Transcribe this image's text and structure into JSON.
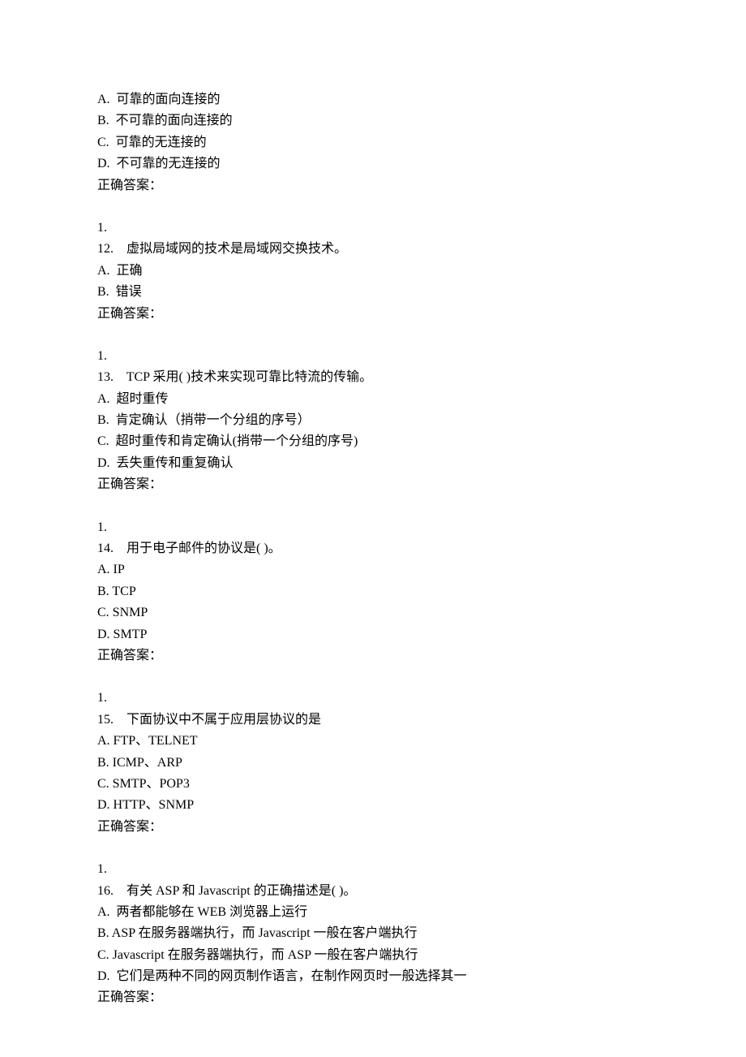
{
  "blocks": [
    {
      "lines": [
        "A.  可靠的面向连接的",
        "B.  不可靠的面向连接的",
        "C.  可靠的无连接的",
        "D.  不可靠的无连接的",
        "正确答案："
      ]
    },
    {
      "lines": [
        "1.",
        "12.    虚拟局域网的技术是局域网交换技术。",
        "A.  正确",
        "B.  错误",
        "正确答案："
      ]
    },
    {
      "lines": [
        "1.",
        "13.    TCP 采用( )技术来实现可靠比特流的传输。",
        "A.  超时重传",
        "B.  肯定确认（捎带一个分组的序号）",
        "C.  超时重传和肯定确认(捎带一个分组的序号)",
        "D.  丢失重传和重复确认",
        "正确答案："
      ]
    },
    {
      "lines": [
        "1.",
        "14.    用于电子邮件的协议是( )。",
        "A. IP",
        "B. TCP",
        "C. SNMP",
        "D. SMTP",
        "正确答案："
      ]
    },
    {
      "lines": [
        "1.",
        "15.    下面协议中不属于应用层协议的是",
        "A. FTP、TELNET",
        "B. ICMP、ARP",
        "C. SMTP、POP3",
        "D. HTTP、SNMP",
        "正确答案："
      ]
    },
    {
      "lines": [
        "1.",
        "16.    有关 ASP 和 Javascript 的正确描述是( )。",
        "A.  两者都能够在 WEB 浏览器上运行",
        "B. ASP 在服务器端执行，而 Javascript 一般在客户端执行",
        "C. Javascript 在服务器端执行，而 ASP 一般在客户端执行",
        "D.  它们是两种不同的网页制作语言，在制作网页时一般选择其一",
        "正确答案："
      ]
    }
  ]
}
